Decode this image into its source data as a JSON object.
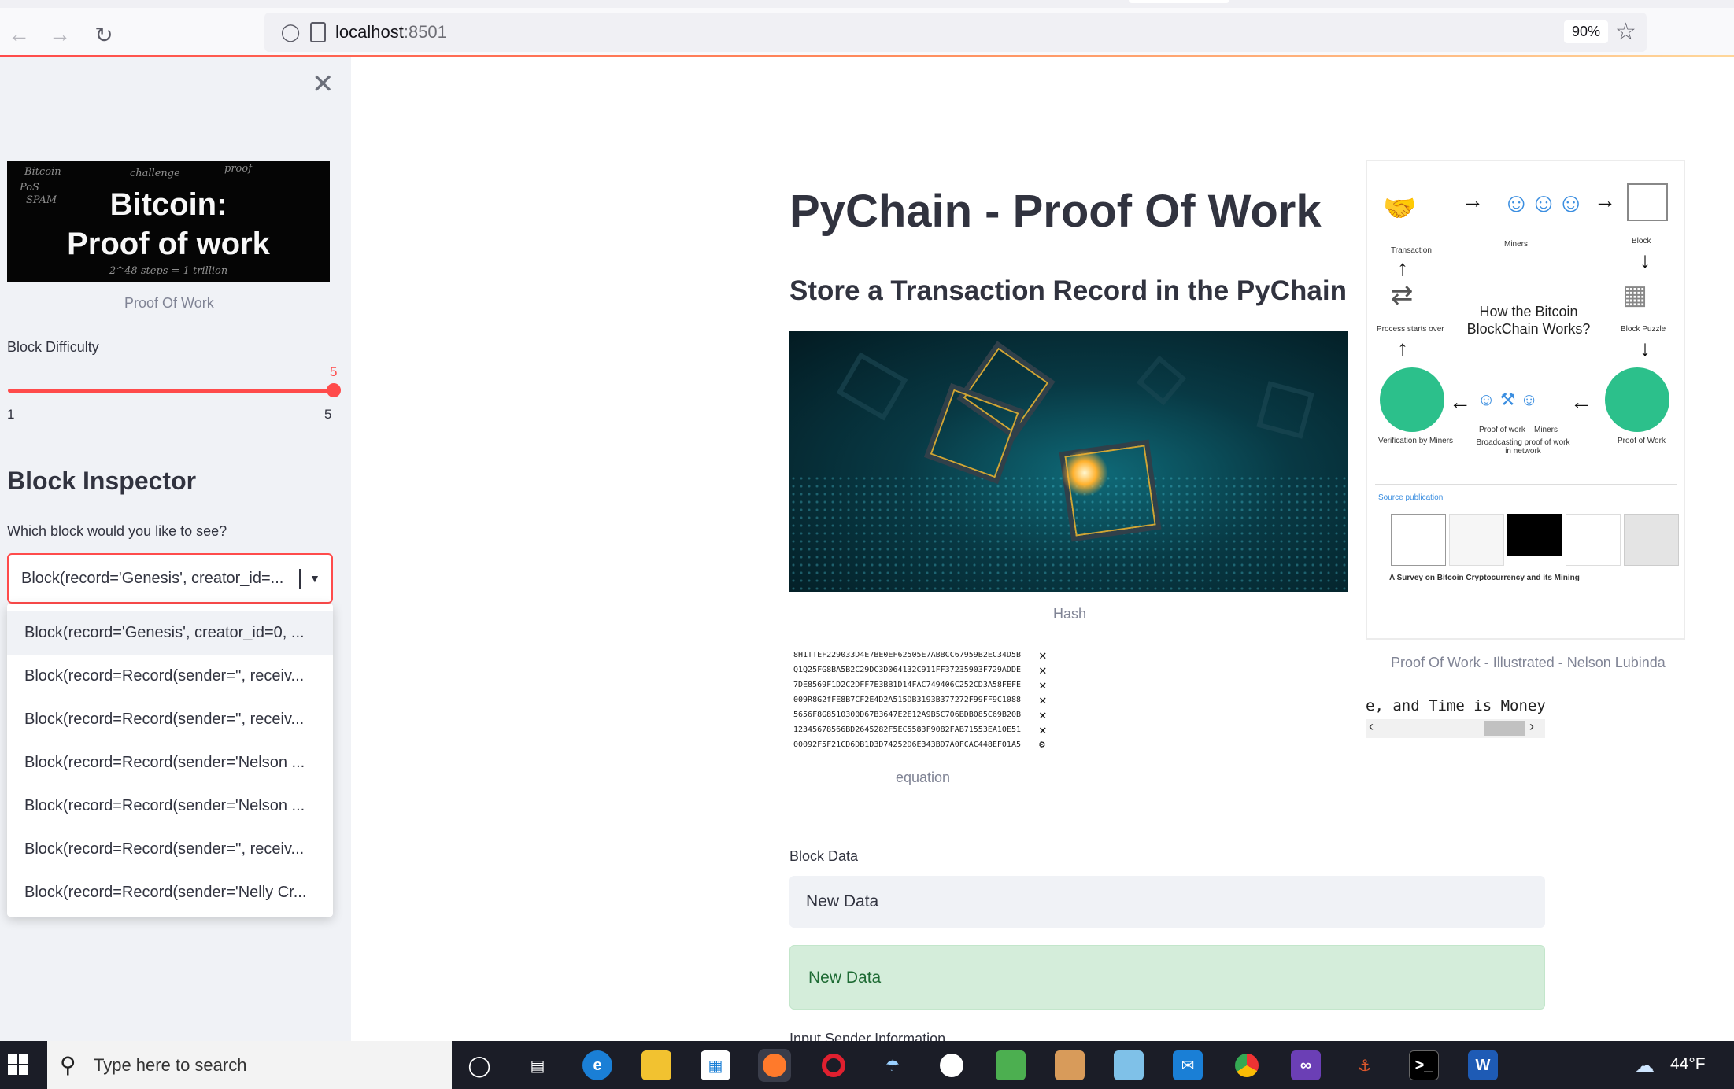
{
  "browser": {
    "url_host": "localhost",
    "url_port": ":8501",
    "zoom": "90%"
  },
  "sidebar": {
    "image_caption": "Proof Of Work",
    "thumb_title_line1": "Bitcoin:",
    "thumb_title_line2": "Proof of work",
    "difficulty_label": "Block Difficulty",
    "difficulty_value": "5",
    "difficulty_min": "1",
    "difficulty_max": "5",
    "inspector_title": "Block Inspector",
    "select_label": "Which block would you like to see?",
    "select_value": "Block(record='Genesis', creator_id=...",
    "options": [
      "Block(record='Genesis', creator_id=0, ...",
      "Block(record=Record(sender='', receiv...",
      "Block(record=Record(sender='', receiv...",
      "Block(record=Record(sender='Nelson ...",
      "Block(record=Record(sender='Nelson ...",
      "Block(record=Record(sender='', receiv...",
      "Block(record=Record(sender='Nelly Cr..."
    ]
  },
  "main": {
    "title": "PyChain - Proof Of Work",
    "subtitle": "Store a Transaction Record in the PyChain",
    "hero_caption": "Hash",
    "hash_lines": [
      "8H1TTEF229033D4E7BE0EF62505E7ABBCC67959B2EC34D5B",
      "Q1Q25FG8BA5B2C29DC3D064132C911FF37235903F729ADDE",
      "7DE8569F1D2C2DFF7E3BB1D14FAC749406C252CD3A58FEFE",
      "009R8G2fFE8B7CF2E4D2A515DB3193B377272F99FF9C1088",
      "5656F8G8510300D67B3647E2E12A9B5C706BDB085C69B20B",
      "12345678566BD2645282F5EC5583F9082FAB71553EA10E51",
      "00092F5F21CD6DB1D3D74252D6E343BD7A0FCAC448EF01A5"
    ],
    "equation_caption": "equation",
    "illustration_caption": "Proof Of Work - Illustrated - Nelson Lubinda",
    "illustration": {
      "title": "How the Bitcoin BlockChain Works?",
      "transaction": "Transaction",
      "miners": "Miners",
      "block": "Block",
      "process_starts": "Process starts over",
      "block_puzzle": "Block Puzzle",
      "verification": "Verification by Miners",
      "proof_of_work": "Proof of Work",
      "pow_small": "Proof of work",
      "miners_small": "Miners",
      "broadcasting": "Broadcasting proof of work in network",
      "source": "Source publication",
      "paper_title": "A Survey on Bitcoin Cryptocurrency and its Mining"
    },
    "code_snippet": "e, and Time is Money",
    "block_data_label": "Block Data",
    "block_data_value": "New Data",
    "success_text": "New Data",
    "next_label": "Input Sender Information"
  },
  "taskbar": {
    "search_placeholder": "Type here to search",
    "temperature": "44°F"
  },
  "colors": {
    "accent": "#ff4b4b",
    "sidebar_bg": "#f0f2f6",
    "success_bg": "#d4edda",
    "taskbar_bg": "#1b1d27"
  }
}
